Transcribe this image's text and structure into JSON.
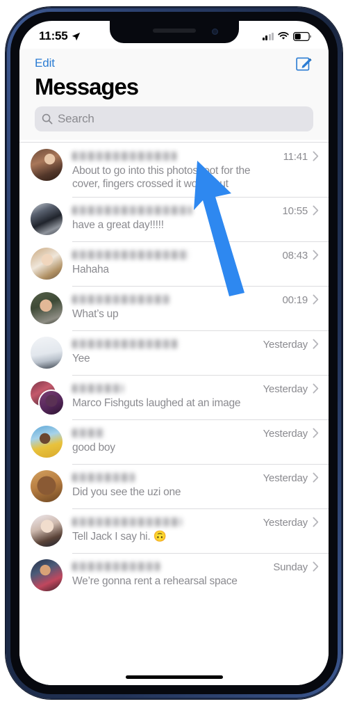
{
  "status_bar": {
    "time": "11:55",
    "location_icon": "location-arrow-icon",
    "signal_icon": "cellular-signal-icon",
    "wifi_icon": "wifi-icon",
    "battery_icon": "battery-icon",
    "signal_bars_filled": 2,
    "signal_bars_total": 4,
    "battery_level_percent": 40
  },
  "header": {
    "edit_label": "Edit",
    "compose_icon": "compose-icon",
    "title": "Messages"
  },
  "search": {
    "placeholder": "Search",
    "value": "",
    "icon": "search-icon"
  },
  "conversations": [
    {
      "name_redacted": true,
      "preview": "About to go into this photoshoot for the cover, fingers crossed it works out",
      "timestamp": "11:41",
      "chevron": "chevron-right-icon",
      "group": false
    },
    {
      "name_redacted": true,
      "preview": "have a great day!!!!!",
      "timestamp": "10:55",
      "chevron": "chevron-right-icon",
      "group": false
    },
    {
      "name_redacted": true,
      "preview": "Hahaha",
      "timestamp": "08:43",
      "chevron": "chevron-right-icon",
      "group": false
    },
    {
      "name_redacted": true,
      "preview": "What’s up",
      "timestamp": "00:19",
      "chevron": "chevron-right-icon",
      "group": false
    },
    {
      "name_redacted": true,
      "preview": "Yee",
      "timestamp": "Yesterday",
      "chevron": "chevron-right-icon",
      "group": false
    },
    {
      "name_redacted": true,
      "preview": "Marco Fishguts laughed at an image",
      "timestamp": "Yesterday",
      "chevron": "chevron-right-icon",
      "group": true
    },
    {
      "name_redacted": true,
      "preview": "good boy",
      "timestamp": "Yesterday",
      "chevron": "chevron-right-icon",
      "group": false
    },
    {
      "name_redacted": true,
      "preview": "Did you see the uzi one",
      "timestamp": "Yesterday",
      "chevron": "chevron-right-icon",
      "group": false
    },
    {
      "name_redacted": true,
      "preview": "Tell Jack I say hi. 🙃",
      "timestamp": "Yesterday",
      "chevron": "chevron-right-icon",
      "group": false
    },
    {
      "name_redacted": true,
      "preview": "We’re gonna rent a rehearsal space",
      "timestamp": "Sunday",
      "chevron": "chevron-right-icon",
      "group": false
    }
  ],
  "annotation": {
    "type": "arrow",
    "points_to": "search-bar",
    "color": "#2e88f0"
  },
  "colors": {
    "accent_blue": "#2b7cd3",
    "arrow_blue": "#2e88f0",
    "search_field_bg": "#e3e3e8",
    "secondary_text": "#8b8b90",
    "header_bg": "#f9f9f9",
    "phone_frame": "#16203a"
  }
}
